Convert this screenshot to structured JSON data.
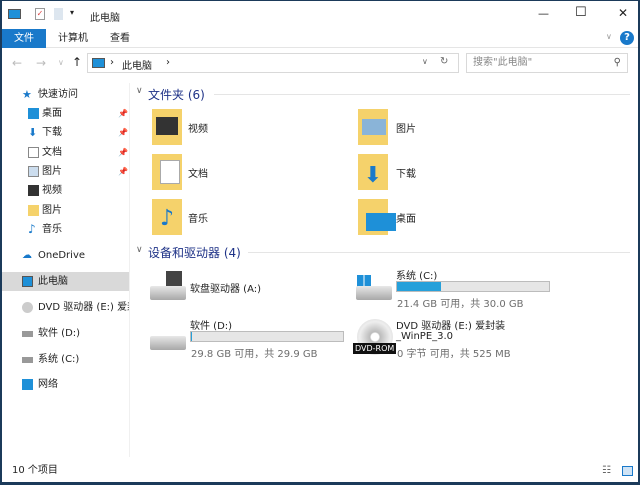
{
  "window": {
    "title": "此电脑"
  },
  "controls": {
    "minimize": "—",
    "maximize": "☐",
    "close": "✕",
    "help": "?",
    "expand": "∨"
  },
  "ribbon": {
    "tabs": [
      "文件",
      "计算机",
      "查看"
    ]
  },
  "address": {
    "path": "此电脑",
    "sep": "›"
  },
  "search": {
    "placeholder": "搜索\"此电脑\""
  },
  "nav": {
    "quick_access": "快速访问",
    "quick_items": [
      {
        "label": "桌面",
        "pinned": true
      },
      {
        "label": "下载",
        "pinned": true
      },
      {
        "label": "文档",
        "pinned": true
      },
      {
        "label": "图片",
        "pinned": true
      },
      {
        "label": "视频"
      },
      {
        "label": "图片"
      },
      {
        "label": "音乐"
      }
    ],
    "onedrive": "OneDrive",
    "this_pc": "此电脑",
    "dvd": "DVD 驱动器 (E:) 爱封",
    "d": "软件 (D:)",
    "c": "系统 (C:)",
    "network": "网络"
  },
  "folders": {
    "header": "文件夹 (6)",
    "items": [
      "视频",
      "图片",
      "文档",
      "下载",
      "音乐",
      "桌面"
    ]
  },
  "devices": {
    "header": "设备和驱动器 (4)",
    "items": [
      {
        "name": "软盘驱动器 (A:)"
      },
      {
        "name": "系统 (C:)",
        "free": "21.4 GB 可用，共 30.0 GB",
        "used_fraction": 0.287
      },
      {
        "name": "软件 (D:)",
        "free": "29.8 GB 可用，共 29.9 GB",
        "used_fraction": 0.003
      },
      {
        "name": "DVD 驱动器 (E:) 爱封装",
        "name2": "_WinPE_3.0",
        "free": "0 字节 可用，共 525 MB",
        "badge": "DVD-ROM"
      }
    ]
  },
  "status": {
    "count": "10 个项目"
  }
}
